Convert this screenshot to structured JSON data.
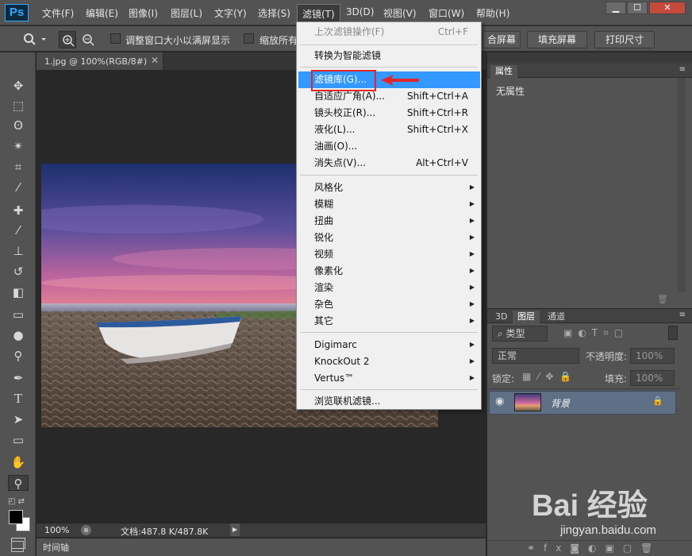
{
  "app": {
    "logo": "Ps"
  },
  "menubar": [
    {
      "label": "文件(F)",
      "active": false
    },
    {
      "label": "编辑(E)",
      "active": false
    },
    {
      "label": "图像(I)",
      "active": false
    },
    {
      "label": "图层(L)",
      "active": false
    },
    {
      "label": "文字(Y)",
      "active": false
    },
    {
      "label": "选择(S)",
      "active": false
    },
    {
      "label": "滤镜(T)",
      "active": true
    },
    {
      "label": "3D(D)",
      "active": false
    },
    {
      "label": "视图(V)",
      "active": false
    },
    {
      "label": "窗口(W)",
      "active": false
    },
    {
      "label": "帮助(H)",
      "active": false
    }
  ],
  "window_controls": {
    "minimize": "▁",
    "maximize": "☐",
    "close": "✕"
  },
  "options": {
    "resize_label": "调整窗口大小以满屏显示",
    "zoom_all_label": "缩放所有",
    "fit_screen": "合屏幕",
    "fill_screen": "填充屏幕",
    "print_size": "打印尺寸"
  },
  "document": {
    "tab_title": "1.jpg @ 100%(RGB/8#)",
    "zoom": "100%",
    "doc_info": "文档:487.8 K/487.8K"
  },
  "timeline_label": "时间轴",
  "filter_menu": {
    "items": [
      {
        "label": "上次滤镜操作(F)",
        "shortcut": "Ctrl+F",
        "disabled": true
      },
      {
        "separator": true
      },
      {
        "label": "转换为智能滤镜"
      },
      {
        "separator": true
      },
      {
        "label": "滤镜库(G)...",
        "highlighted": true
      },
      {
        "label": "自适应广角(A)...",
        "shortcut": "Shift+Ctrl+A"
      },
      {
        "label": "镜头校正(R)...",
        "shortcut": "Shift+Ctrl+R"
      },
      {
        "label": "液化(L)...",
        "shortcut": "Shift+Ctrl+X"
      },
      {
        "label": "油画(O)..."
      },
      {
        "label": "消失点(V)...",
        "shortcut": "Alt+Ctrl+V"
      },
      {
        "separator": true
      },
      {
        "label": "风格化",
        "submenu": true
      },
      {
        "label": "模糊",
        "submenu": true
      },
      {
        "label": "扭曲",
        "submenu": true
      },
      {
        "label": "锐化",
        "submenu": true
      },
      {
        "label": "视频",
        "submenu": true
      },
      {
        "label": "像素化",
        "submenu": true
      },
      {
        "label": "渲染",
        "submenu": true
      },
      {
        "label": "杂色",
        "submenu": true
      },
      {
        "label": "其它",
        "submenu": true
      },
      {
        "separator": true
      },
      {
        "label": "Digimarc",
        "submenu": true
      },
      {
        "label": "KnockOut 2",
        "submenu": true
      },
      {
        "label": "Vertus™",
        "submenu": true
      },
      {
        "separator": true
      },
      {
        "label": "浏览联机滤镜..."
      }
    ]
  },
  "properties_panel": {
    "tab": "属性",
    "empty_text": "无属性"
  },
  "layers_panel": {
    "tabs": [
      "3D",
      "图层",
      "通道"
    ],
    "active_tab": "图层",
    "filter_kind": "类型",
    "blend_mode": "正常",
    "opacity_label": "不透明度:",
    "opacity_value": "100%",
    "lock_label": "锁定:",
    "fill_label": "填充:",
    "fill_value": "100%",
    "layer_name": "背景"
  },
  "watermark": {
    "logo_text": "Bai 经验",
    "url": "jingyan.baidu.com"
  },
  "colors": {
    "accent": "#3398ff",
    "highlight_box": "#e5242a",
    "ui_bg": "#535353",
    "ps_blue": "#31a8ff"
  }
}
